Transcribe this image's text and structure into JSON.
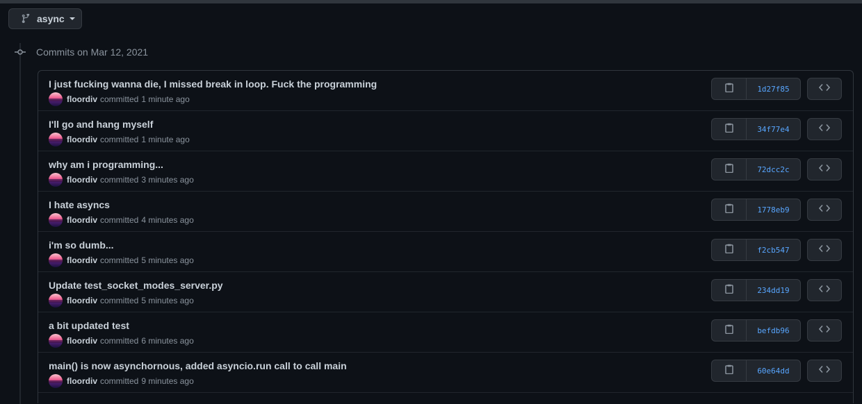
{
  "branch": {
    "name": "async"
  },
  "group": {
    "date_label": "Commits on Mar 12, 2021"
  },
  "colors": {
    "background": "#0d1117",
    "text": "#c9d1d9",
    "muted": "#8b949e",
    "sha_link": "#58a6ff",
    "border": "#30363d"
  },
  "commits": [
    {
      "message": "I just fucking wanna die, I missed break in loop. Fuck the programming",
      "author": "floordiv",
      "action": "committed",
      "time": "1 minute ago",
      "sha": "1d27f85"
    },
    {
      "message": "I'll go and hang myself",
      "author": "floordiv",
      "action": "committed",
      "time": "1 minute ago",
      "sha": "34f77e4"
    },
    {
      "message": "why am i programming...",
      "author": "floordiv",
      "action": "committed",
      "time": "3 minutes ago",
      "sha": "72dcc2c"
    },
    {
      "message": "I hate asyncs",
      "author": "floordiv",
      "action": "committed",
      "time": "4 minutes ago",
      "sha": "1778eb9"
    },
    {
      "message": "i'm so dumb...",
      "author": "floordiv",
      "action": "committed",
      "time": "5 minutes ago",
      "sha": "f2cb547"
    },
    {
      "message": "Update test_socket_modes_server.py",
      "author": "floordiv",
      "action": "committed",
      "time": "5 minutes ago",
      "sha": "234dd19"
    },
    {
      "message": "a bit updated test",
      "author": "floordiv",
      "action": "committed",
      "time": "6 minutes ago",
      "sha": "befdb96"
    },
    {
      "message": "main() is now asynchornous, added asyncio.run call to call main",
      "author": "floordiv",
      "action": "committed",
      "time": "9 minutes ago",
      "sha": "60e64dd"
    }
  ],
  "icons": {
    "branch": "git-branch-icon",
    "caret": "caret-down-icon",
    "commit_node": "git-commit-icon",
    "copy": "clipboard-icon",
    "browse": "code-icon"
  }
}
